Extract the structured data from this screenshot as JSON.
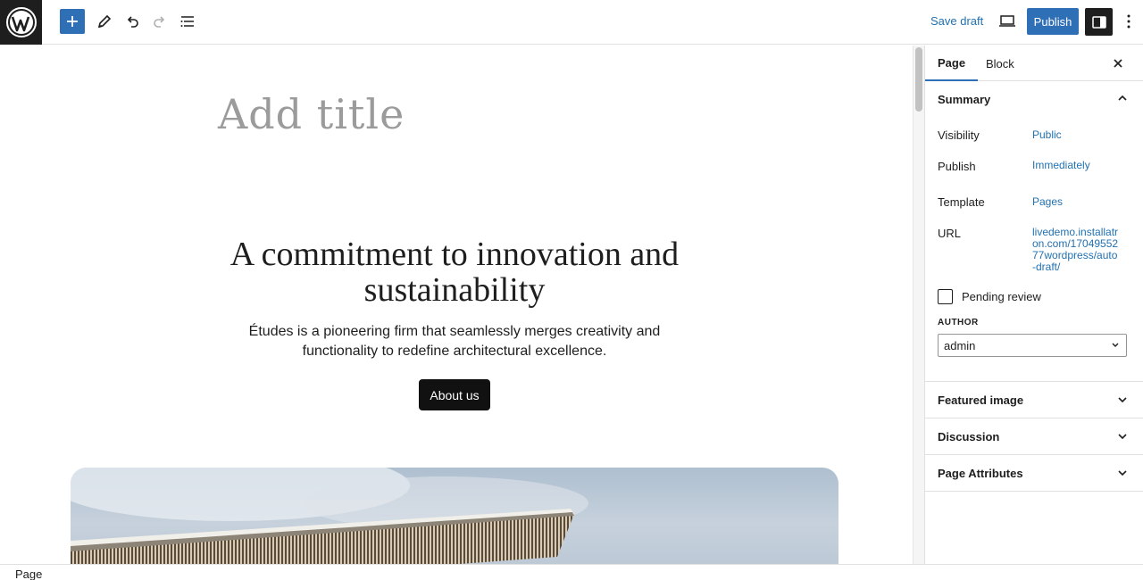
{
  "toolbar": {
    "save_draft": "Save draft",
    "publish": "Publish",
    "accent_color": "#2f6fb6"
  },
  "canvas": {
    "title_placeholder": "Add title",
    "headline": "A commitment to innovation and sustainability",
    "subtext": "Études is a pioneering firm that seamlessly merges creativity and functionality to redefine architectural excellence.",
    "button_label": "About us"
  },
  "sidebar": {
    "tabs": [
      {
        "label": "Page"
      },
      {
        "label": "Block"
      }
    ],
    "summary": {
      "heading": "Summary",
      "visibility_label": "Visibility",
      "visibility_value": "Public",
      "publish_label": "Publish",
      "publish_value": "Immediately",
      "template_label": "Template",
      "template_value": "Pages",
      "url_label": "URL",
      "url_value": "livedemo.installatron.com/1704955277wordpress/auto-draft/",
      "pending_label": "Pending review",
      "author_label": "AUTHOR",
      "author_value": "admin"
    },
    "panels": [
      {
        "label": "Featured image"
      },
      {
        "label": "Discussion"
      },
      {
        "label": "Page Attributes"
      }
    ]
  },
  "footer": {
    "breadcrumb": "Page"
  }
}
